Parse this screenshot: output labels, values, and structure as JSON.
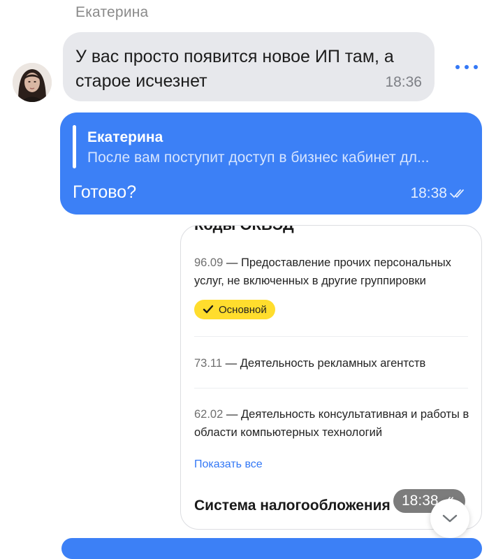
{
  "incoming": {
    "sender_name": "Екатерина",
    "text": "У вас просто появится новое ИП там, а старое исчезнет",
    "time": "18:36"
  },
  "outgoing": {
    "quote_name": "Екатерина",
    "quote_text": "После вам поступит доступ в бизнес кабинет дл...",
    "text": "Готово?",
    "time": "18:38",
    "status_icon": "double-check-icon"
  },
  "card": {
    "heading": "Коды ОКВЭД",
    "items": [
      {
        "code": "96.09",
        "desc": " — Предоставление прочих персональных услуг, не включенных в другие группировки"
      },
      {
        "code": "73.11",
        "desc": " — Деятельность рекламных агентств"
      },
      {
        "code": "62.02",
        "desc": " — Деятельность консультативная и работы в области компьютерных технологий"
      }
    ],
    "badge_label": "Основной",
    "show_all": "Показать все",
    "section_title": "Система налогообложения",
    "time": "18:38"
  },
  "colors": {
    "accent": "#3c80f6",
    "incoming_bubble": "#e7e8ec",
    "badge": "#ffdd2d",
    "link": "#3378f6"
  }
}
